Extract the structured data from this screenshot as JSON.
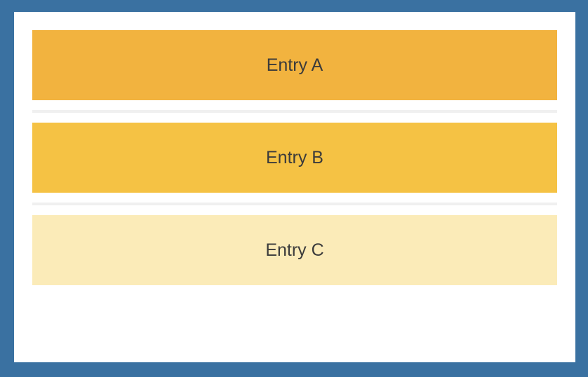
{
  "entries": [
    {
      "label": "Entry A",
      "color": "#f2b33f"
    },
    {
      "label": "Entry B",
      "color": "#f5c244"
    },
    {
      "label": "Entry C",
      "color": "#fbebb8"
    }
  ],
  "frame": {
    "border_color": "#3a71a1",
    "background": "#ffffff"
  }
}
